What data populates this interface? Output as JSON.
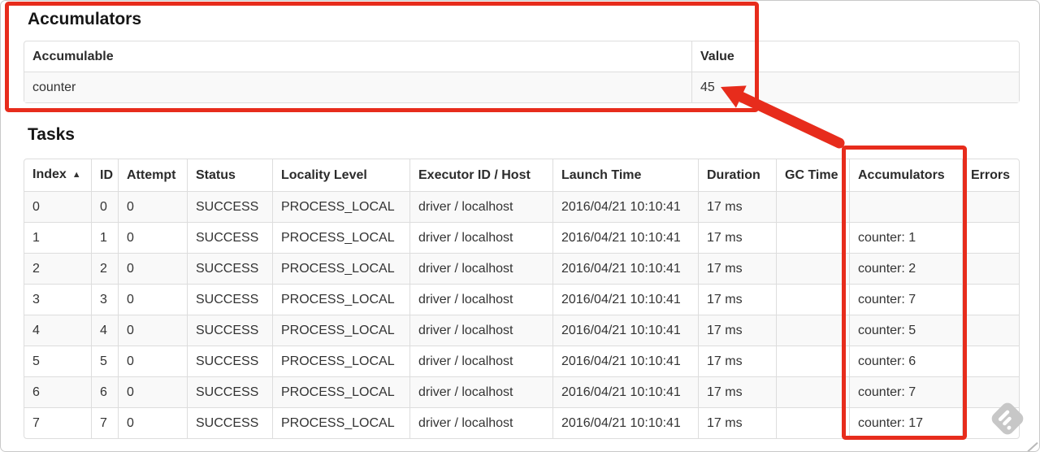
{
  "accumulators_section": {
    "heading": "Accumulators",
    "table": {
      "headers": [
        "Accumulable",
        "Value"
      ],
      "rows": [
        [
          "counter",
          "45"
        ]
      ]
    }
  },
  "tasks_section": {
    "heading": "Tasks",
    "table": {
      "sort_indicator": "▲",
      "headers": [
        "Index",
        "ID",
        "Attempt",
        "Status",
        "Locality Level",
        "Executor ID / Host",
        "Launch Time",
        "Duration",
        "GC Time",
        "Accumulators",
        "Errors"
      ],
      "rows": [
        [
          "0",
          "0",
          "0",
          "SUCCESS",
          "PROCESS_LOCAL",
          "driver / localhost",
          "2016/04/21 10:10:41",
          "17 ms",
          "",
          "",
          ""
        ],
        [
          "1",
          "1",
          "0",
          "SUCCESS",
          "PROCESS_LOCAL",
          "driver / localhost",
          "2016/04/21 10:10:41",
          "17 ms",
          "",
          "counter: 1",
          ""
        ],
        [
          "2",
          "2",
          "0",
          "SUCCESS",
          "PROCESS_LOCAL",
          "driver / localhost",
          "2016/04/21 10:10:41",
          "17 ms",
          "",
          "counter: 2",
          ""
        ],
        [
          "3",
          "3",
          "0",
          "SUCCESS",
          "PROCESS_LOCAL",
          "driver / localhost",
          "2016/04/21 10:10:41",
          "17 ms",
          "",
          "counter: 7",
          ""
        ],
        [
          "4",
          "4",
          "0",
          "SUCCESS",
          "PROCESS_LOCAL",
          "driver / localhost",
          "2016/04/21 10:10:41",
          "17 ms",
          "",
          "counter: 5",
          ""
        ],
        [
          "5",
          "5",
          "0",
          "SUCCESS",
          "PROCESS_LOCAL",
          "driver / localhost",
          "2016/04/21 10:10:41",
          "17 ms",
          "",
          "counter: 6",
          ""
        ],
        [
          "6",
          "6",
          "0",
          "SUCCESS",
          "PROCESS_LOCAL",
          "driver / localhost",
          "2016/04/21 10:10:41",
          "17 ms",
          "",
          "counter: 7",
          ""
        ],
        [
          "7",
          "7",
          "0",
          "SUCCESS",
          "PROCESS_LOCAL",
          "driver / localhost",
          "2016/04/21 10:10:41",
          "17 ms",
          "",
          "counter: 17",
          ""
        ]
      ]
    }
  },
  "annotations": {
    "highlight_color": "#e72c1c"
  }
}
